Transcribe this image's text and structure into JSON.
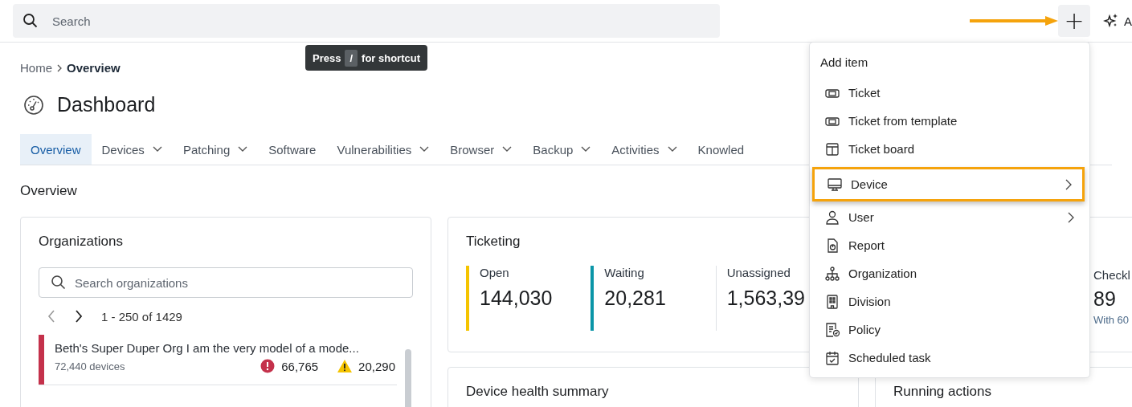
{
  "topbar": {
    "search": {
      "placeholder": "Search"
    },
    "add_button": "+",
    "ai_button": "A"
  },
  "tooltip": {
    "before": "Press",
    "key": "/",
    "after": "for shortcut"
  },
  "breadcrumb": [
    {
      "label": "Home"
    },
    {
      "label": "Overview"
    }
  ],
  "page_title": "Dashboard",
  "tabs": [
    {
      "label": "Overview",
      "selected": true,
      "dropdown": false
    },
    {
      "label": "Devices",
      "selected": false,
      "dropdown": true
    },
    {
      "label": "Patching",
      "selected": false,
      "dropdown": true
    },
    {
      "label": "Software",
      "selected": false,
      "dropdown": false
    },
    {
      "label": "Vulnerabilities",
      "selected": false,
      "dropdown": true
    },
    {
      "label": "Browser",
      "selected": false,
      "dropdown": true
    },
    {
      "label": "Backup",
      "selected": false,
      "dropdown": true
    },
    {
      "label": "Activities",
      "selected": false,
      "dropdown": true
    },
    {
      "label": "Knowled",
      "selected": false,
      "dropdown": false
    }
  ],
  "section_title": "Overview",
  "organizations": {
    "title": "Organizations",
    "search": {
      "placeholder": "Search organizations"
    },
    "range": "1 - 250 of 1429",
    "rows": [
      {
        "name": "Beth's Super Duper Org I am the very model of a mode...",
        "devices": "72,440 devices",
        "errors": "66,765",
        "warnings": "20,290",
        "color": "#c4314b"
      }
    ]
  },
  "ticketing": {
    "title": "Ticketing",
    "stats": [
      {
        "label": "Open",
        "value": "144,030",
        "color": "#f5c400"
      },
      {
        "label": "Waiting",
        "value": "20,281",
        "color": "#0b96a8"
      },
      {
        "label": "Unassigned",
        "value": "1,563,39"
      }
    ]
  },
  "side_stat": {
    "label": "Checkl",
    "value": "89",
    "note": "With 60"
  },
  "bottom_cards": [
    {
      "title": "Device health summary"
    },
    {
      "title": "Running actions"
    }
  ],
  "add_menu": {
    "title": "Add item",
    "items": [
      {
        "label": "Ticket",
        "submenu": false,
        "highlighted": false
      },
      {
        "label": "Ticket from template",
        "submenu": false,
        "highlighted": false
      },
      {
        "label": "Ticket board",
        "submenu": false,
        "highlighted": false
      },
      {
        "label": "Device",
        "submenu": true,
        "highlighted": true
      },
      {
        "label": "User",
        "submenu": true,
        "highlighted": false
      },
      {
        "label": "Report",
        "submenu": false,
        "highlighted": false
      },
      {
        "label": "Organization",
        "submenu": false,
        "highlighted": false
      },
      {
        "label": "Division",
        "submenu": false,
        "highlighted": false
      },
      {
        "label": "Policy",
        "submenu": false,
        "highlighted": false
      },
      {
        "label": "Scheduled task",
        "submenu": false,
        "highlighted": false
      }
    ]
  }
}
